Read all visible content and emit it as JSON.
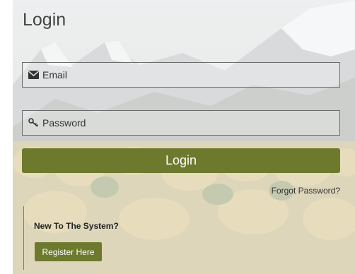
{
  "page": {
    "title": "Login"
  },
  "form": {
    "email_placeholder": "Email",
    "email_icon": "envelope-icon",
    "password_placeholder": "Password",
    "password_icon": "key-icon",
    "login_label": "Login",
    "forgot_label": "Forgot Password?"
  },
  "register": {
    "prompt": "New To The System?",
    "button_label": "Register Here"
  },
  "colors": {
    "accent": "#6d7a2e"
  }
}
